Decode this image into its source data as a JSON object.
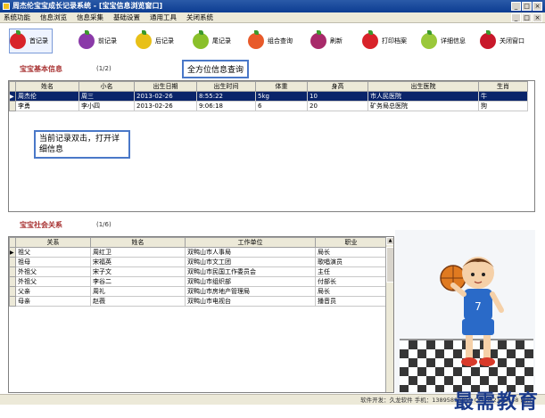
{
  "window": {
    "title": "周杰伦宝宝成长记录系统 - [宝宝信息浏览窗口]"
  },
  "menu": [
    "系统功能",
    "信息浏览",
    "信息采集",
    "基础设置",
    "通用工具",
    "关闭系统"
  ],
  "toolbar": [
    {
      "label": "首记录",
      "color": "#d8232a",
      "icon": "apple-icon"
    },
    {
      "label": "前记录",
      "color": "#8a3aa8",
      "icon": "plum-icon"
    },
    {
      "label": "后记录",
      "color": "#e8c018",
      "icon": "lemon-icon"
    },
    {
      "label": "尾记录",
      "color": "#8ac02a",
      "icon": "pear-icon"
    },
    {
      "label": "组合查询",
      "color": "#e85a2a",
      "icon": "peach-icon"
    },
    {
      "label": "刷新",
      "color": "#a82a6a",
      "icon": "grape-icon"
    },
    {
      "label": "打印档案",
      "color": "#d8232a",
      "icon": "strawberry-icon"
    },
    {
      "label": "详细信息",
      "color": "#9ac83a",
      "icon": "apple-green-icon"
    },
    {
      "label": "关闭窗口",
      "color": "#c8182a",
      "icon": "apple-red-icon"
    }
  ],
  "basic": {
    "title": "宝宝基本信息",
    "count": "(1/2)",
    "columns": [
      "姓名",
      "小名",
      "出生日期",
      "出生时间",
      "体重",
      "身高",
      "出生医院",
      "生肖"
    ],
    "rows": [
      [
        "周杰伦",
        "周三",
        "2013-02-26",
        "8:55:22",
        "5kg",
        "10",
        "市人民医院",
        "牛"
      ],
      [
        "李勇",
        "李小四",
        "2013-02-26",
        "9:06:18",
        "6",
        "20",
        "矿务局总医院",
        "狗"
      ]
    ]
  },
  "social": {
    "title": "宝宝社会关系",
    "count": "(1/6)",
    "columns": [
      "关系",
      "姓名",
      "工作单位",
      "职业"
    ],
    "rows": [
      [
        "祖父",
        "周红卫",
        "双鸭山市人事局",
        "局长"
      ],
      [
        "祖母",
        "宋福英",
        "双鸭山市文工团",
        "歌唱演员"
      ],
      [
        "外祖父",
        "宋子文",
        "双鸭山市民国工作委员会",
        "主任"
      ],
      [
        "外祖父",
        "李谷二",
        "双鸭山市组织部",
        "付部长"
      ],
      [
        "父亲",
        "周礼",
        "双鸭山市房地产管理局",
        "局长"
      ],
      [
        "母亲",
        "赵薇",
        "双鸭山市电视台",
        "播音员"
      ]
    ]
  },
  "callouts": {
    "query": "全方位信息查询",
    "dblclick": "当前记录双击，打开详细信息"
  },
  "status": "软件开发：久龙软件    手机：13895896059    QQ:582115148    邮件：",
  "watermark": "最需教育",
  "colors": {
    "titlebar": "#0d3d92",
    "selection": "#0a246a",
    "section": "#a83232",
    "callout_border": "#4a78c8"
  }
}
